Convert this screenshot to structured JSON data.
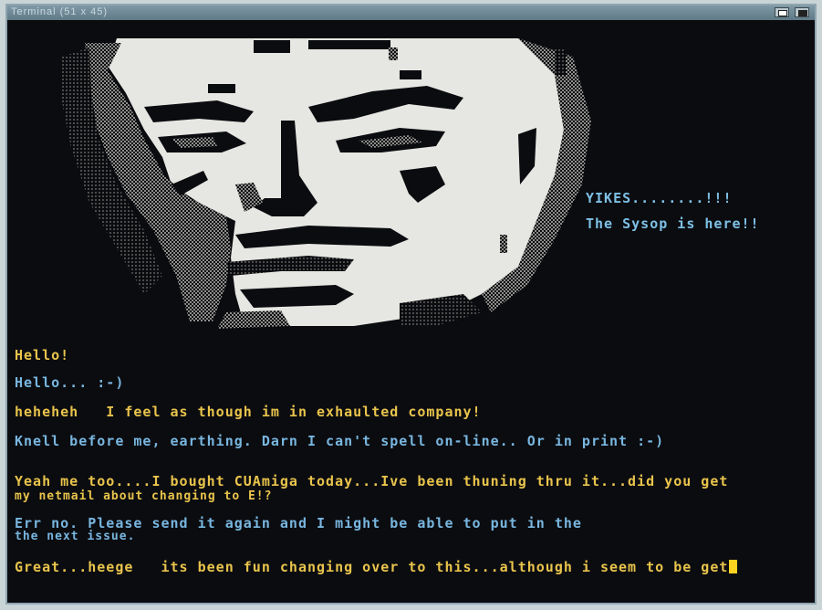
{
  "window": {
    "title": "Terminal (51 x 45)"
  },
  "sysop_notice": {
    "line1": "YIKES........!!!",
    "line2": "The Sysop is here!!"
  },
  "chat": [
    {
      "text": "Hello!",
      "color": "#e9c44c"
    },
    {
      "text": "Hello... :-)",
      "color": "#78b6df"
    },
    {
      "text": "heheheh   I feel as though im in exhaulted company!",
      "color": "#e9c44c"
    },
    {
      "text": "Knell before me, earthing. Darn I can't spell on-line.. Or in print :-)",
      "color": "#78b6df"
    },
    {
      "text": "Yeah me too....I bought CUAmiga today...Ive been thuning thru it...did you get",
      "color": "#e9c44c"
    },
    {
      "text": "my netmail about changing to E!?",
      "color": "#e9c44c"
    },
    {
      "text": "Err no. Please send it again and I might be able to put in the",
      "color": "#78b6df"
    },
    {
      "text": "the next issue.",
      "color": "#78b6df"
    },
    {
      "text": "Great...heege   its been fun changing over to this...although i seem to be get",
      "color": "#e9c44c"
    }
  ],
  "colors": {
    "terminal_bg": "#0b0c10",
    "art_light": "#e6e6e2",
    "yellow_text": "#e9c44c",
    "blue_text": "#78b6df",
    "cursor": "#ffd21f"
  }
}
